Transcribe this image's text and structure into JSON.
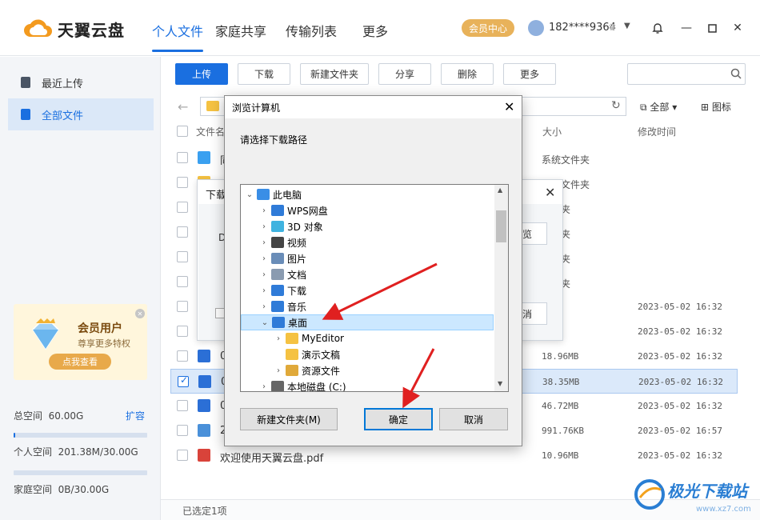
{
  "header": {
    "logo_text": "天翼云盘",
    "tabs": [
      {
        "label": "个人文件",
        "active": true
      },
      {
        "label": "家庭共享",
        "active": false
      },
      {
        "label": "传输列表",
        "active": false
      },
      {
        "label": "更多",
        "active": false
      }
    ],
    "vip_label": "会员中心",
    "account": "182****9364"
  },
  "sidebar": {
    "items": [
      {
        "label": "最近上传",
        "icon": "recent-icon",
        "active": false
      },
      {
        "label": "全部文件",
        "icon": "files-icon",
        "active": true
      }
    ],
    "promo": {
      "title": "会员用户",
      "subtitle": "尊享更多特权",
      "button": "点我查看"
    },
    "total_space_label": "总空间",
    "total_space_value": "60.00G",
    "expand_label": "扩容",
    "personal_space_label": "个人空间",
    "personal_space_value": "201.38M/30.00G",
    "personal_fill": 0.01,
    "family_space_label": "家庭空间",
    "family_space_value": "0B/30.00G",
    "family_fill": 0
  },
  "toolbar": {
    "upload": "上传",
    "download": "下载",
    "new_folder": "新建文件夹",
    "share": "分享",
    "delete": "删除",
    "more": "更多",
    "filter_all": "全部",
    "view_mode": "图标"
  },
  "table": {
    "col_name": "文件名",
    "col_size": "大小",
    "col_date": "修改时间",
    "rows": [
      {
        "name": "同",
        "size": "系统文件夹",
        "date": "",
        "icon": "sync-folder-icon",
        "color": "#3aa0f0",
        "checked": false
      },
      {
        "name": "",
        "size": "系统文件夹",
        "date": "",
        "icon": "folder-icon",
        "color": "#f5c242",
        "checked": false
      },
      {
        "name": "",
        "size": "文件夹",
        "date": "",
        "icon": "folder-icon",
        "color": "#f5c242",
        "checked": false
      },
      {
        "name": "",
        "size": "文件夹",
        "date": "",
        "icon": "folder-icon",
        "color": "#f5c242",
        "checked": false
      },
      {
        "name": "",
        "size": "文件夹",
        "date": "",
        "icon": "folder-icon",
        "color": "#f5c242",
        "checked": false
      },
      {
        "name": "",
        "size": "文件夹",
        "date": "",
        "icon": "folder-icon",
        "color": "#f5c242",
        "checked": false
      },
      {
        "name": "",
        "size": "3MB",
        "date": "2023-05-02 16:32",
        "icon": "file-icon",
        "color": "#f5c242",
        "checked": false
      },
      {
        "name": "",
        "size": "1MB",
        "date": "2023-05-02 16:32",
        "icon": "file-icon",
        "color": "#f5c242",
        "checked": false
      },
      {
        "name": "0",
        "size": "18.96MB",
        "date": "2023-05-02 16:32",
        "icon": "video-icon",
        "color": "#2b6fd6",
        "checked": false
      },
      {
        "name": "0",
        "size": "38.35MB",
        "date": "2023-05-02 16:32",
        "icon": "video-icon",
        "color": "#2b6fd6",
        "checked": true
      },
      {
        "name": "0",
        "size": "46.72MB",
        "date": "2023-05-02 16:32",
        "icon": "video-icon",
        "color": "#2b6fd6",
        "checked": false
      },
      {
        "name": "2",
        "size": "991.76KB",
        "date": "2023-05-02 16:57",
        "icon": "image-icon",
        "color": "#4a90d9",
        "checked": false
      },
      {
        "name": "欢迎使用天翼云盘.pdf",
        "size": "10.96MB",
        "date": "2023-05-02 16:32",
        "icon": "pdf-icon",
        "color": "#d9433a",
        "checked": false
      }
    ]
  },
  "status": "已选定1项",
  "download_dialog": {
    "title": "下载",
    "path_prefix": "D",
    "browse_label": "览",
    "cancel_label": "消"
  },
  "browse_dialog": {
    "title": "浏览计算机",
    "prompt": "请选择下载路径",
    "tree": [
      {
        "label": "此电脑",
        "level": 0,
        "twist": "open",
        "icon": "pc-icon",
        "color": "#3a8ee6"
      },
      {
        "label": "WPS网盘",
        "level": 1,
        "twist": "closed",
        "icon": "cloud-icon",
        "color": "#2f7bd8"
      },
      {
        "label": "3D 对象",
        "level": 1,
        "twist": "closed",
        "icon": "cube-icon",
        "color": "#3fb3e0"
      },
      {
        "label": "视频",
        "level": 1,
        "twist": "closed",
        "icon": "film-icon",
        "color": "#444"
      },
      {
        "label": "图片",
        "level": 1,
        "twist": "closed",
        "icon": "picture-icon",
        "color": "#6a8db8"
      },
      {
        "label": "文档",
        "level": 1,
        "twist": "closed",
        "icon": "document-icon",
        "color": "#8a9bb0"
      },
      {
        "label": "下载",
        "level": 1,
        "twist": "closed",
        "icon": "download-icon",
        "color": "#2f7bd8"
      },
      {
        "label": "音乐",
        "level": 1,
        "twist": "closed",
        "icon": "music-icon",
        "color": "#2f7bd8"
      },
      {
        "label": "桌面",
        "level": 1,
        "twist": "open",
        "icon": "desktop-icon",
        "color": "#2f7bd8",
        "selected": true
      },
      {
        "label": "MyEditor",
        "level": 2,
        "twist": "closed",
        "icon": "folder-icon",
        "color": "#f5c242"
      },
      {
        "label": "演示文稿",
        "level": 2,
        "twist": "none",
        "icon": "folder-icon",
        "color": "#f5c242"
      },
      {
        "label": "资源文件",
        "level": 2,
        "twist": "closed",
        "icon": "folder-icon",
        "color": "#e0a93a"
      },
      {
        "label": "本地磁盘 (C:)",
        "level": 1,
        "twist": "closed",
        "icon": "drive-icon",
        "color": "#666"
      }
    ],
    "new_folder_label": "新建文件夹(M)",
    "ok_label": "确定",
    "cancel_label": "取消"
  },
  "watermark": {
    "text": "极光下载站",
    "url": "www.xz7.com"
  },
  "colors": {
    "accent": "#1a6fe0",
    "vip": "#e8b25a",
    "annotation_arrow": "#e02020"
  }
}
